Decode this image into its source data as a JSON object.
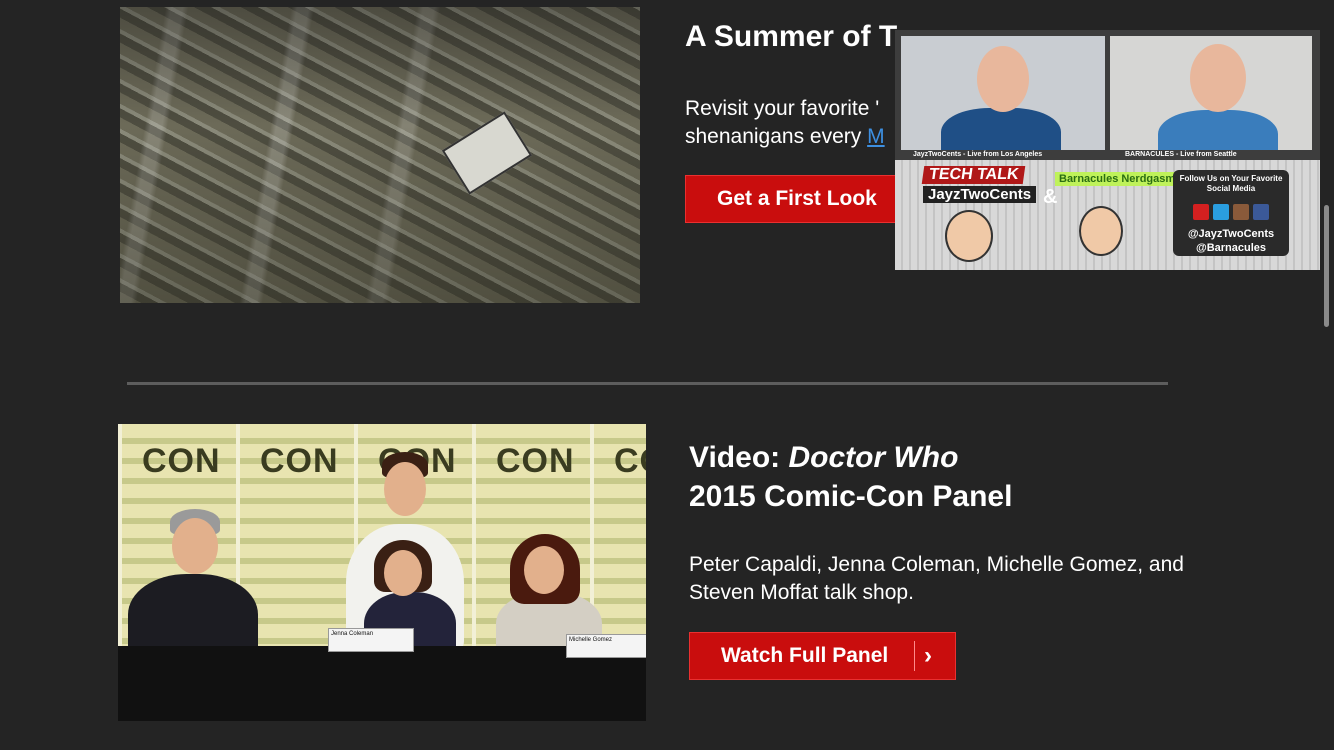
{
  "section1": {
    "title": "A Summer of T",
    "desc_line1": "Revisit your favorite '",
    "desc_line2": "shenanigans every ",
    "desc_link": "M",
    "button_label": "Get a First Look"
  },
  "section2": {
    "title_prefix": "Video: ",
    "title_italic": "Doctor Who",
    "title_line2": "2015 Comic-Con Panel",
    "description": "Peter Capaldi, Jenna Coleman, Michelle Gomez, and Steven Moffat talk shop.",
    "button_label": "Watch Full Panel",
    "photo": {
      "banner_text": "CON",
      "nameplate_1": "Jenna Coleman",
      "nameplate_2": "Michelle Gomez"
    }
  },
  "video_overlay": {
    "cam1_label": "JayzTwoCents - Live from Los Angeles",
    "cam2_label": "BARNACULES - Live from Seattle",
    "show_title_line1": "TECH TALK",
    "show_title_line2": "JayzTwoCents",
    "show_title_amp": "&",
    "show_title_partner": "Barnacules Nerdgasm",
    "follow_text": "Follow Us on Your Favorite Social Media",
    "handle_1": "@JayzTwoCents",
    "handle_2": "@Barnacules"
  },
  "colors": {
    "background": "#242424",
    "button_red": "#c90d0d",
    "link_blue": "#3d8fe0"
  }
}
